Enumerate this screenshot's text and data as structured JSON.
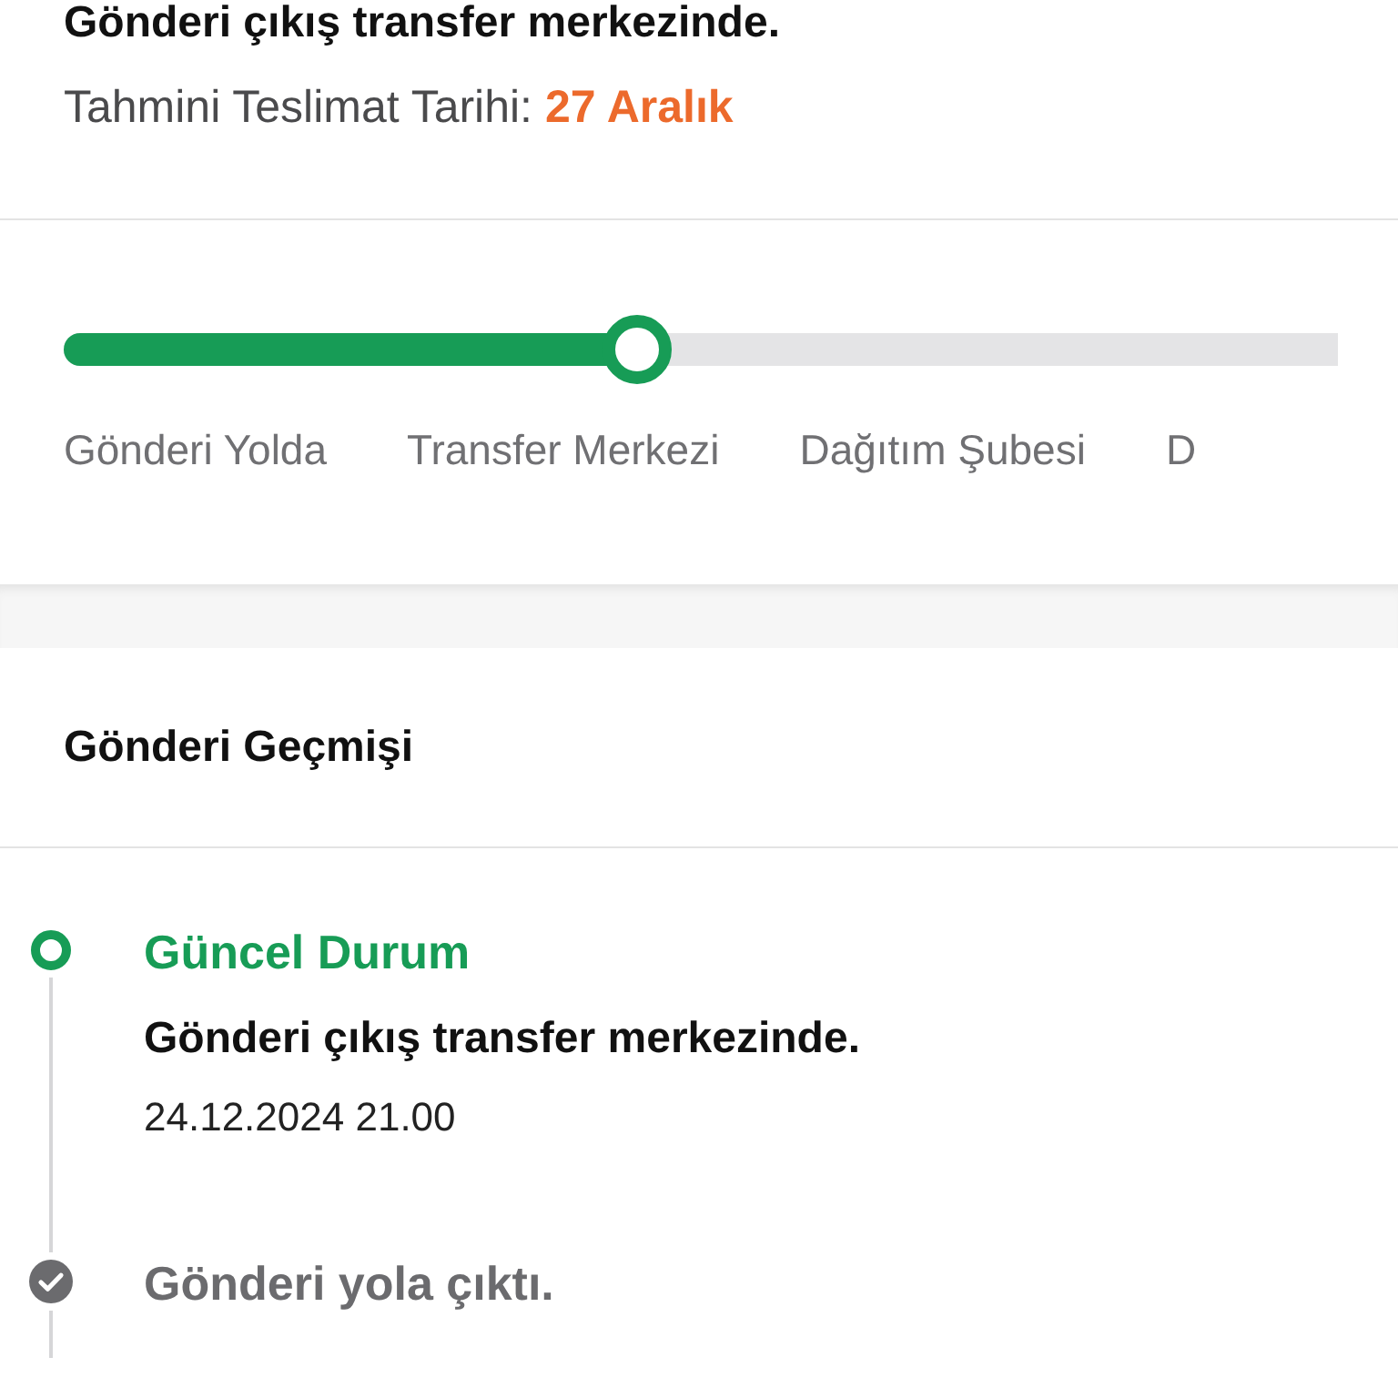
{
  "summary": {
    "status": "Gönderi çıkış transfer merkezinde.",
    "eta_label": "Tahmini Teslimat Tarihi:",
    "eta_value": "27 Aralık"
  },
  "progress": {
    "level": 0.45,
    "steps": [
      "Gönderi Yolda",
      "Transfer Merkezi",
      "Dağıtım Şubesi",
      "D"
    ]
  },
  "history": {
    "title": "Gönderi Geçmişi",
    "events": [
      {
        "kind": "current",
        "title": "Güncel Durum",
        "description": "Gönderi çıkış transfer merkezinde.",
        "time": "24.12.2024 21.00"
      },
      {
        "kind": "done",
        "title": "Gönderi yola çıktı."
      }
    ]
  }
}
